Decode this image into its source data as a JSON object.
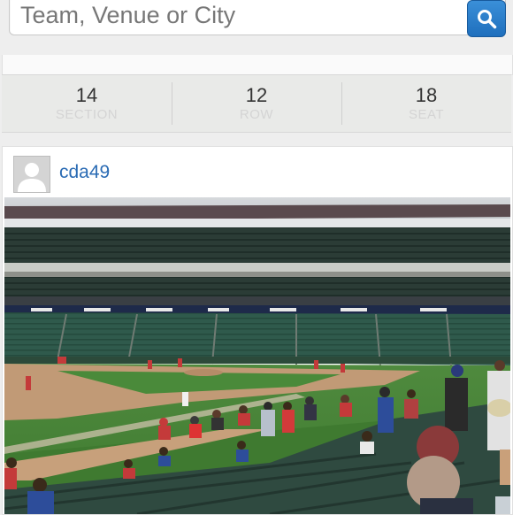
{
  "search": {
    "placeholder": "Team, Venue or City",
    "button_icon": "search-icon"
  },
  "seat": {
    "section": {
      "value": "14",
      "label": "SECTION"
    },
    "row": {
      "value": "12",
      "label": "ROW"
    },
    "seat": {
      "value": "18",
      "label": "SEAT"
    }
  },
  "post": {
    "username": "cda49",
    "avatar_icon": "default-avatar-icon"
  },
  "colors": {
    "accent": "#1f6fbd",
    "link": "#2a6bb4",
    "seat_bar_bg": "#e9eae8"
  }
}
